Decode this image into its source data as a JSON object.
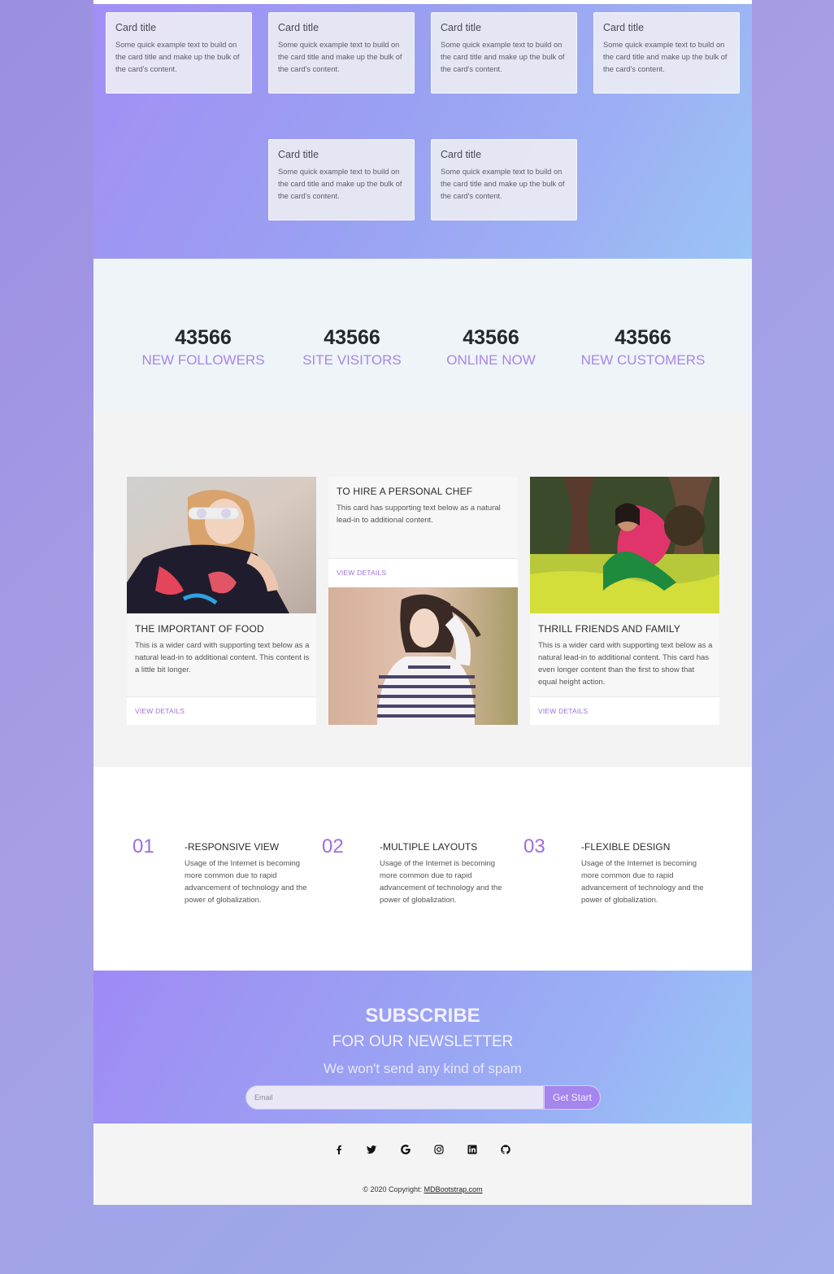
{
  "cards": [
    {
      "title": "Card title",
      "text": "Some quick example text to build on the card title and make up the bulk of the card's content."
    },
    {
      "title": "Card title",
      "text": "Some quick example text to build on the card title and make up the bulk of the card's content."
    },
    {
      "title": "Card title",
      "text": "Some quick example text to build on the card title and make up the bulk of the card's content."
    },
    {
      "title": "Card title",
      "text": "Some quick example text to build on the card title and make up the bulk of the card's content."
    },
    {
      "title": "Card title",
      "text": "Some quick example text to build on the card title and make up the bulk of the card's content."
    },
    {
      "title": "Card title",
      "text": "Some quick example text to build on the card title and make up the bulk of the card's content."
    }
  ],
  "stats": [
    {
      "value": "43566",
      "label": "NEW FOLLOWERS"
    },
    {
      "value": "43566",
      "label": "SITE VISITORS"
    },
    {
      "value": "43566",
      "label": "ONLINE NOW"
    },
    {
      "value": "43566",
      "label": "NEW CUSTOMERS"
    }
  ],
  "features": {
    "left": {
      "title": "THE IMPORTANT OF FOOD",
      "text": "This is a wider card with supporting text below as a natural lead-in to additional content. This content is a little bit longer.",
      "link": "VIEW DETAILS"
    },
    "middle": {
      "title": "TO HIRE A PERSONAL CHEF",
      "text": "This card has supporting text below as a natural lead-in to additional content.",
      "link": "VIEW DETAILS"
    },
    "right": {
      "title": "THRILL FRIENDS AND FAMILY",
      "text": "This is a wider card with supporting text below as a natural lead-in to additional content. This card has even longer content than the first to show that equal height action.",
      "link": "VIEW DETAILS"
    }
  },
  "steps": [
    {
      "num": "01",
      "title": "-RESPONSIVE VIEW",
      "text": "Usage of the Internet is becoming more common due to rapid advancement of technology and the power of globalization."
    },
    {
      "num": "02",
      "title": "-MULTIPLE LAYOUTS",
      "text": "Usage of the Internet is becoming more common due to rapid advancement of technology and the power of globalization."
    },
    {
      "num": "03",
      "title": "-FLEXIBLE DESIGN",
      "text": "Usage of the Internet is becoming more common due to rapid advancement of technology and the power of globalization."
    }
  ],
  "subscribe": {
    "title": "SUBSCRIBE",
    "subtitle": "FOR OUR NEWSLETTER",
    "tagline": "We won't send any kind of spam",
    "placeholder": "Email",
    "button": "Get Start"
  },
  "footer": {
    "social_icons": [
      "facebook-icon",
      "twitter-icon",
      "google-icon",
      "instagram-icon",
      "linkedin-icon",
      "github-icon"
    ],
    "copyright_prefix": "© 2020 Copyright: ",
    "copyright_link": "MDBootstrap.com"
  },
  "colors": {
    "accent_purple": "#a887e6",
    "step_number": "#9d6ee0",
    "link_purple": "#9c72d8"
  }
}
